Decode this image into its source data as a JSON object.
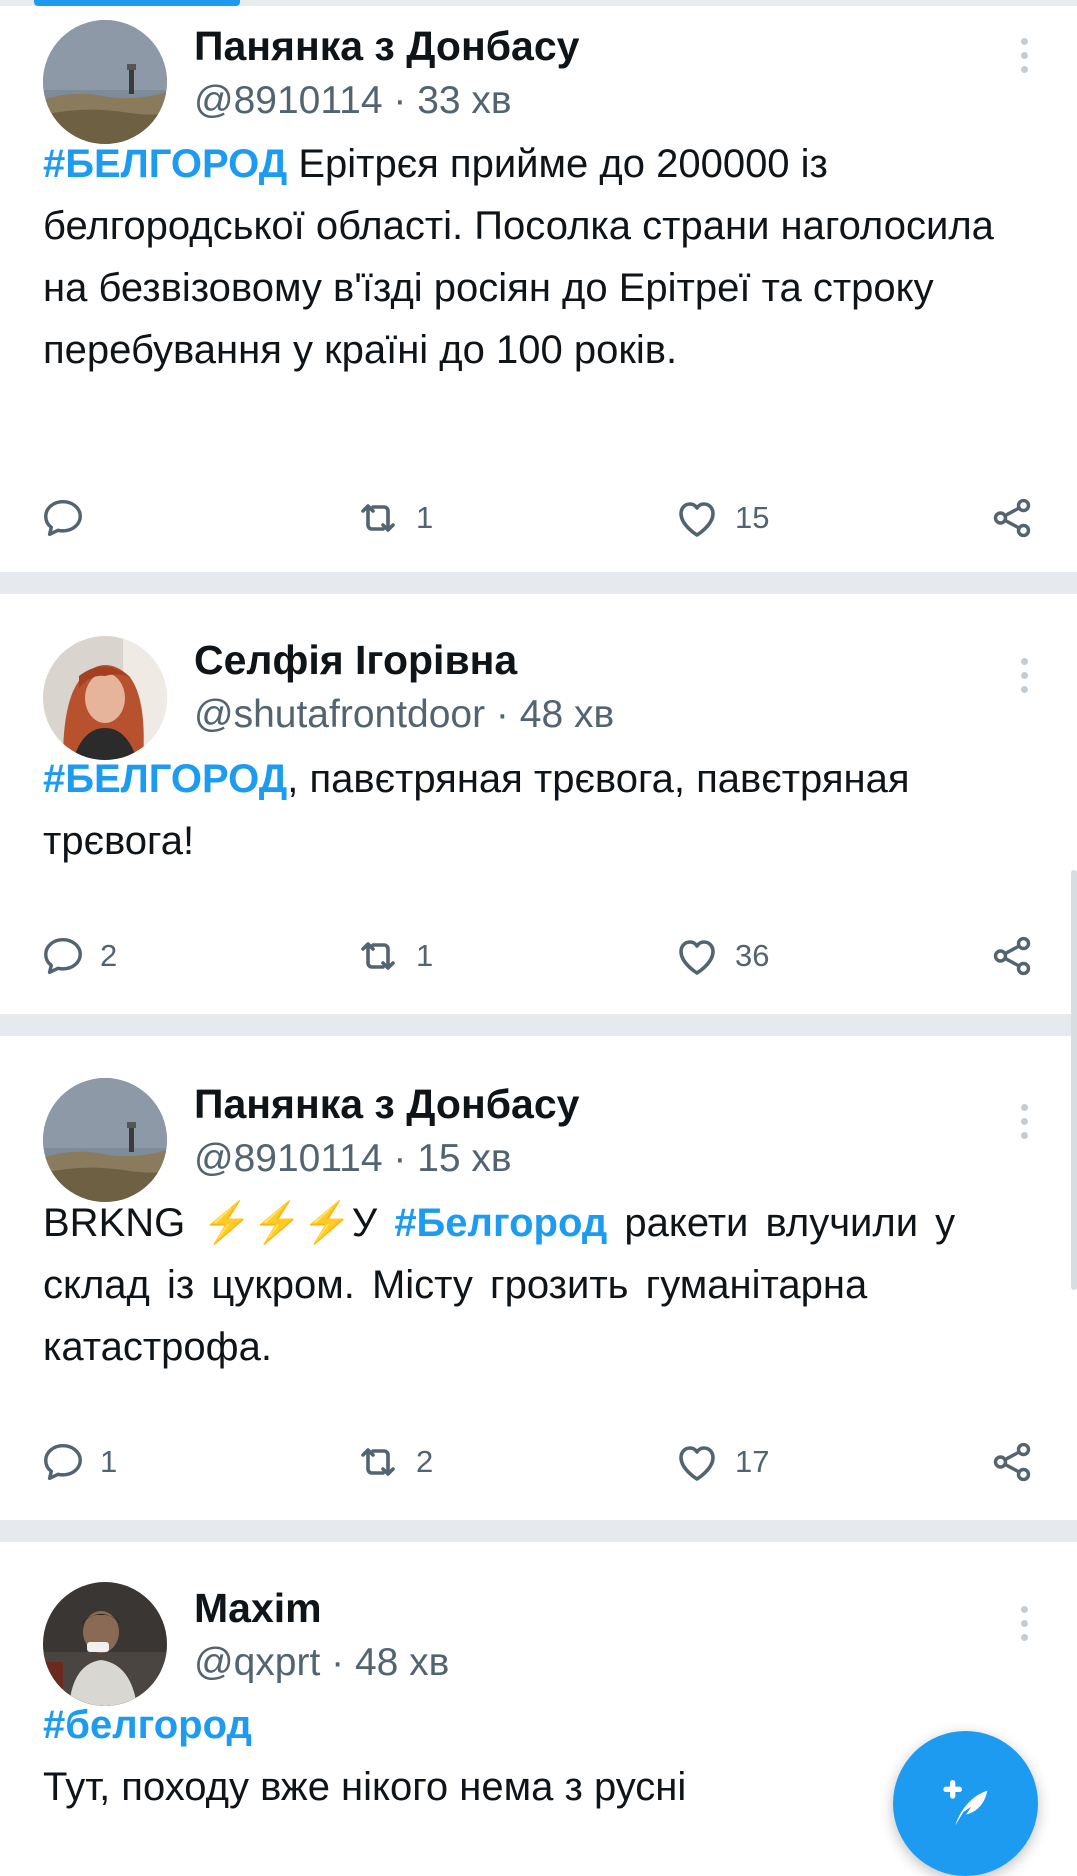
{
  "tweets": [
    {
      "name": "Панянка з Донбасу",
      "handle": "@8910114",
      "time": "33 хв",
      "hashtag": "#БЕЛГОРОД",
      "text": " Ерітрєя прийме до 200000 із белгородської області. Посолка страни наголосила на безвізовому в'їзді росіян до Ерітреї та строку перебування у країні до 100 років.",
      "replies": "",
      "retweets": "1",
      "likes": "15"
    },
    {
      "name": "Селфія Ігорівна",
      "handle": "@shutafrontdoor",
      "time": "48 хв",
      "hashtag": "#БЕЛГОРОД",
      "text": ", павєтряная трєвога, павєтряная трєвога!",
      "replies": "2",
      "retweets": "1",
      "likes": "36"
    },
    {
      "name": "Панянка з Донбасу",
      "handle": "@8910114",
      "time": "15 хв",
      "text_before": "BRKNG ",
      "emoji": "⚡⚡⚡",
      "text_mid": "У ",
      "hashtag": "#Белгород",
      "text": " ракети  влучили у склад із цукром. Місту грозить гуманітарна  катастрофа.",
      "replies": "1",
      "retweets": "2",
      "likes": "17"
    },
    {
      "name": "Maxim",
      "handle": "@qxprt",
      "time": "48 хв",
      "hashtag": "#белгород",
      "text": "Тут, походу вже нікого нема з русні"
    }
  ],
  "meta_separator": " · ",
  "icons": {
    "more": "more-vertical-icon",
    "reply": "reply-icon",
    "retweet": "retweet-icon",
    "like": "heart-icon",
    "share": "share-icon",
    "compose": "compose-feather-icon"
  },
  "colors": {
    "accent": "#1d9bf0",
    "muted": "#536471",
    "text": "#0f1419",
    "divider": "#e6eaee"
  }
}
